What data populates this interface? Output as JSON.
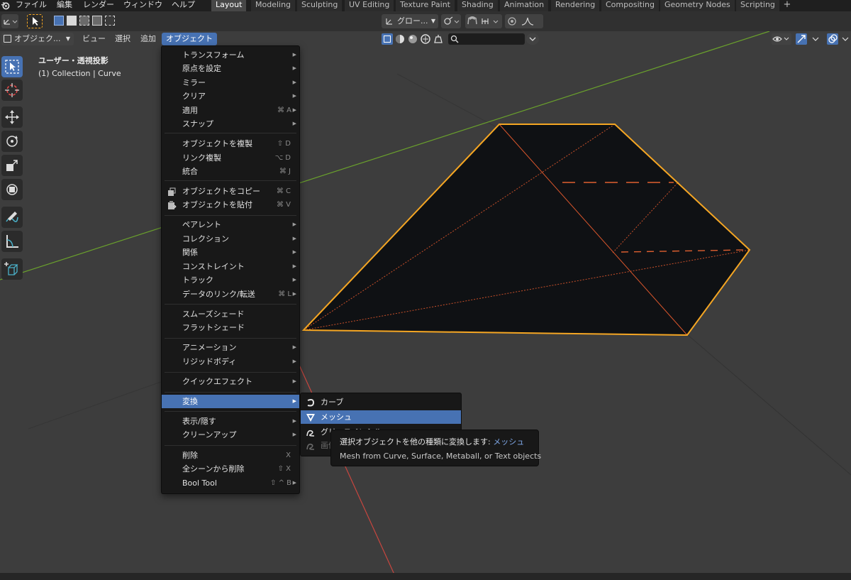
{
  "topbar": {
    "menus": [
      "ファイル",
      "編集",
      "レンダー",
      "ウィンドウ",
      "ヘルプ"
    ],
    "workspaces": [
      "Layout",
      "Modeling",
      "Sculpting",
      "UV Editing",
      "Texture Paint",
      "Shading",
      "Animation",
      "Rendering",
      "Compositing",
      "Geometry Nodes",
      "Scripting"
    ],
    "active_workspace": "Layout",
    "add_tab": "+"
  },
  "toolbar": {
    "transform_orientation": "グロー..."
  },
  "header": {
    "editor_mode": "オブジェク...",
    "menus": [
      "ビュー",
      "選択",
      "追加",
      "オブジェクト"
    ],
    "active_menu": "オブジェクト"
  },
  "viewport": {
    "info_line1": "ユーザー・透視投影",
    "info_line2": "(1) Collection | Curve"
  },
  "colors": {
    "accent": "#4772b3",
    "selection": "#f5a623",
    "x_axis": "#c8463f",
    "y_axis": "#6aa12c"
  },
  "object_menu": {
    "items": [
      {
        "label": "トランスフォーム",
        "shortcut": "",
        "arrow": true
      },
      {
        "label": "原点を設定",
        "shortcut": "",
        "arrow": true
      },
      {
        "label": "ミラー",
        "shortcut": "",
        "arrow": true
      },
      {
        "label": "クリア",
        "shortcut": "",
        "arrow": true
      },
      {
        "label": "適用",
        "shortcut": "⌘ A",
        "arrow": true
      },
      {
        "label": "スナップ",
        "shortcut": "",
        "arrow": true
      },
      {
        "label": "オブジェクトを複製",
        "shortcut": "⇧ D",
        "arrow": false
      },
      {
        "label": "リンク複製",
        "shortcut": "⌥ D",
        "arrow": false
      },
      {
        "label": "統合",
        "shortcut": "⌘ J",
        "arrow": false
      },
      {
        "label": "オブジェクトをコピー",
        "shortcut": "⌘ C",
        "arrow": false,
        "icon": "copy-icon"
      },
      {
        "label": "オブジェクトを貼付",
        "shortcut": "⌘ V",
        "arrow": false,
        "icon": "paste-icon"
      },
      {
        "label": "ペアレント",
        "shortcut": "",
        "arrow": true
      },
      {
        "label": "コレクション",
        "shortcut": "",
        "arrow": true
      },
      {
        "label": "関係",
        "shortcut": "",
        "arrow": true
      },
      {
        "label": "コンストレイント",
        "shortcut": "",
        "arrow": true
      },
      {
        "label": "トラック",
        "shortcut": "",
        "arrow": true
      },
      {
        "label": "データのリンク/転送",
        "shortcut": "⌘ L",
        "arrow": true
      },
      {
        "label": "スムーズシェード",
        "shortcut": "",
        "arrow": false
      },
      {
        "label": "フラットシェード",
        "shortcut": "",
        "arrow": false
      },
      {
        "label": "アニメーション",
        "shortcut": "",
        "arrow": true
      },
      {
        "label": "リジッドボディ",
        "shortcut": "",
        "arrow": true
      },
      {
        "label": "クイックエフェクト",
        "shortcut": "",
        "arrow": true
      },
      {
        "label": "変換",
        "shortcut": "",
        "arrow": true,
        "highlighted": true
      },
      {
        "label": "表示/隠す",
        "shortcut": "",
        "arrow": true
      },
      {
        "label": "クリーンアップ",
        "shortcut": "",
        "arrow": true
      },
      {
        "label": "削除",
        "shortcut": "X",
        "arrow": false
      },
      {
        "label": "全シーンから削除",
        "shortcut": "⇧ X",
        "arrow": false
      },
      {
        "label": "Bool Tool",
        "shortcut": "⇧ ^ B",
        "arrow": true
      }
    ]
  },
  "convert_submenu": {
    "items": [
      {
        "label": "カーブ",
        "icon": "curve-icon"
      },
      {
        "label": "メッシュ",
        "icon": "mesh-icon",
        "highlighted": true
      },
      {
        "label": "グリースペンシル",
        "icon": "grease-pencil-icon"
      },
      {
        "label": "画像",
        "icon": "image-icon",
        "disabled": true
      }
    ]
  },
  "tooltip": {
    "line1_prefix": "選択オブジェクトを他の種類に変換します:",
    "line1_value": "メッシュ",
    "line2": "Mesh from Curve, Surface, Metaball, or Text objects"
  }
}
